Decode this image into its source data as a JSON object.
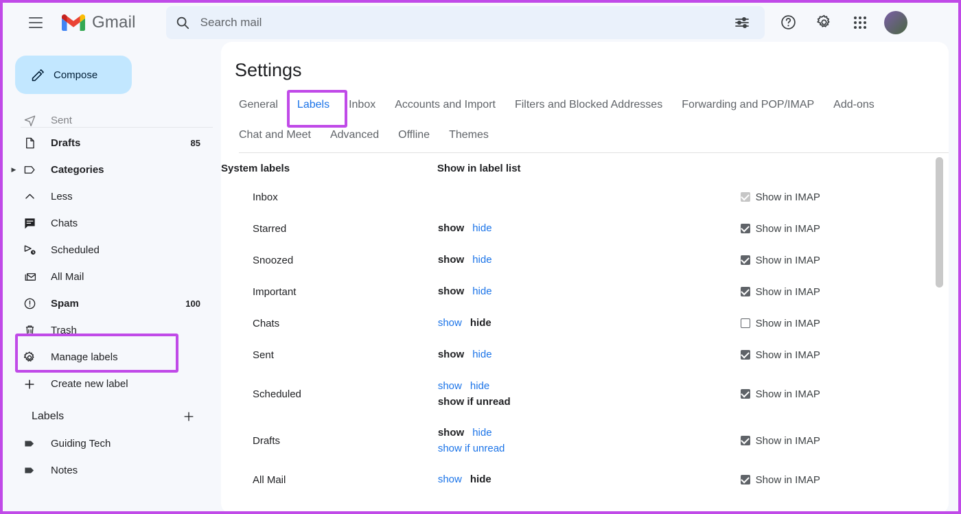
{
  "app": {
    "brand": "Gmail",
    "logo_colors": {
      "red": "#ea4335",
      "blue": "#4285f4",
      "green": "#34a853",
      "yellow": "#fbbc04"
    },
    "accent_highlight": "#c04ae8",
    "link_color": "#1a73e8"
  },
  "topbar": {
    "menu_icon": "hamburger-icon",
    "search": {
      "placeholder": "Search mail",
      "value": ""
    },
    "tune_icon": "tune-icon",
    "help_icon": "help-icon",
    "settings_icon": "gear-icon",
    "apps_icon": "apps-grid-icon",
    "avatar": "account-avatar"
  },
  "sidebar": {
    "compose_label": "Compose",
    "compose_icon": "pencil-icon",
    "peek_item": "Sent",
    "items": [
      {
        "label": "Drafts",
        "icon": "document-icon",
        "count": "85",
        "bold": true,
        "expander": false
      },
      {
        "label": "Categories",
        "icon": "tag-outline-icon",
        "count": "",
        "bold": true,
        "expander": true
      },
      {
        "label": "Less",
        "icon": "chevron-up-icon",
        "count": "",
        "bold": false,
        "expander": false
      },
      {
        "label": "Chats",
        "icon": "chat-icon",
        "count": "",
        "bold": false,
        "expander": false
      },
      {
        "label": "Scheduled",
        "icon": "scheduled-send-icon",
        "count": "",
        "bold": false,
        "expander": false
      },
      {
        "label": "All Mail",
        "icon": "all-mail-icon",
        "count": "",
        "bold": false,
        "expander": false
      },
      {
        "label": "Spam",
        "icon": "spam-icon",
        "count": "100",
        "bold": true,
        "expander": false
      },
      {
        "label": "Trash",
        "icon": "trash-icon",
        "count": "",
        "bold": false,
        "expander": false
      },
      {
        "label": "Manage labels",
        "icon": "gear-icon",
        "count": "",
        "bold": false,
        "expander": false
      },
      {
        "label": "Create new label",
        "icon": "plus-icon",
        "count": "",
        "bold": false,
        "expander": false
      }
    ],
    "labels_section": {
      "title": "Labels",
      "add_icon": "plus-icon",
      "labels": [
        {
          "label": "Guiding Tech",
          "icon": "label-tag-icon"
        },
        {
          "label": "Notes",
          "icon": "label-tag-icon"
        }
      ]
    }
  },
  "main": {
    "title": "Settings",
    "tabs_row1": [
      {
        "label": "General",
        "active": false
      },
      {
        "label": "Labels",
        "active": true
      },
      {
        "label": "Inbox",
        "active": false
      },
      {
        "label": "Accounts and Import",
        "active": false
      },
      {
        "label": "Filters and Blocked Addresses",
        "active": false
      },
      {
        "label": "Forwarding and POP/IMAP",
        "active": false
      },
      {
        "label": "Add-ons",
        "active": false
      }
    ],
    "tabs_row2": [
      {
        "label": "Chat and Meet",
        "active": false
      },
      {
        "label": "Advanced",
        "active": false
      },
      {
        "label": "Offline",
        "active": false
      },
      {
        "label": "Themes",
        "active": false
      }
    ],
    "table": {
      "headers": {
        "name": "System labels",
        "show": "Show in label list",
        "imap": ""
      },
      "imap_label": "Show in IMAP",
      "rows": [
        {
          "name": "Inbox",
          "actions": [],
          "imap_state": "disabled"
        },
        {
          "name": "Starred",
          "actions": [
            {
              "label": "show",
              "selected": true
            },
            {
              "label": "hide",
              "selected": false
            }
          ],
          "imap_state": "checked"
        },
        {
          "name": "Snoozed",
          "actions": [
            {
              "label": "show",
              "selected": true
            },
            {
              "label": "hide",
              "selected": false
            }
          ],
          "imap_state": "checked"
        },
        {
          "name": "Important",
          "actions": [
            {
              "label": "show",
              "selected": true
            },
            {
              "label": "hide",
              "selected": false
            }
          ],
          "imap_state": "checked"
        },
        {
          "name": "Chats",
          "actions": [
            {
              "label": "show",
              "selected": false
            },
            {
              "label": "hide",
              "selected": true
            }
          ],
          "imap_state": "unchecked"
        },
        {
          "name": "Sent",
          "actions": [
            {
              "label": "show",
              "selected": true
            },
            {
              "label": "hide",
              "selected": false
            }
          ],
          "imap_state": "checked"
        },
        {
          "name": "Scheduled",
          "actions": [
            {
              "label": "show",
              "selected": false
            },
            {
              "label": "hide",
              "selected": false
            },
            {
              "label": "show if unread",
              "selected": true,
              "newline": true
            }
          ],
          "imap_state": "checked"
        },
        {
          "name": "Drafts",
          "actions": [
            {
              "label": "show",
              "selected": true
            },
            {
              "label": "hide",
              "selected": false
            },
            {
              "label": "show if unread",
              "selected": false,
              "newline": true
            }
          ],
          "imap_state": "checked"
        },
        {
          "name": "All Mail",
          "actions": [
            {
              "label": "show",
              "selected": false
            },
            {
              "label": "hide",
              "selected": true
            }
          ],
          "imap_state": "checked"
        }
      ]
    }
  },
  "annotations": {
    "highlight_manage_labels": "Manage labels",
    "highlight_labels_tab": "Labels"
  }
}
